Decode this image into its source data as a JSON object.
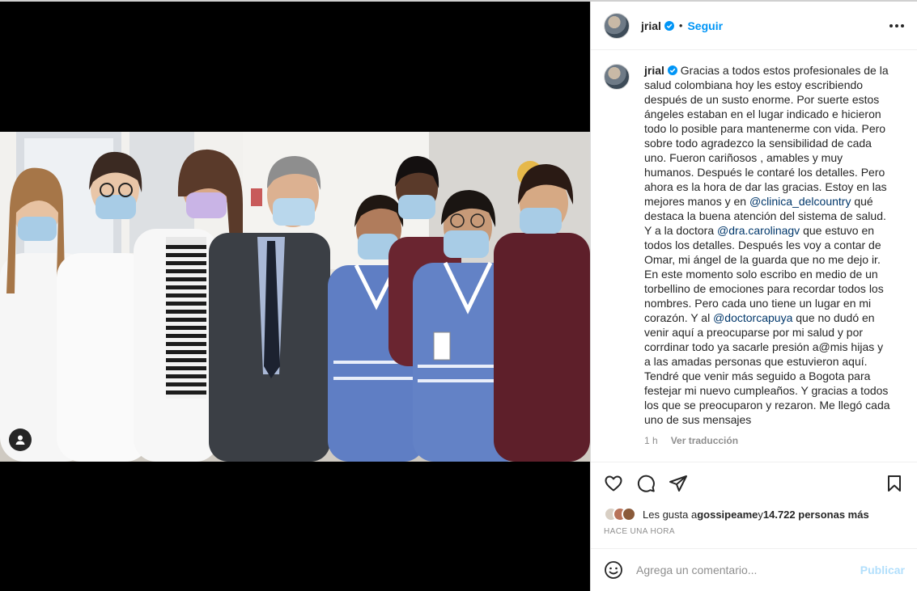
{
  "post": {
    "username": "jrial",
    "follow_label": "Seguir",
    "dot": "•",
    "photo_alt": "Grupo de profesionales de la salud con un hombre de traje en un hospital"
  },
  "caption": {
    "username": "jrial",
    "text_part1": "Gracias a todos estos profesionales de la salud colombiana hoy les estoy escribiendo después de un susto enorme. Por suerte estos ángeles estaban en el lugar indicado e hicieron todo lo posible para mantenerme con vida. Pero sobre todo agradezco la sensibilidad de cada uno. Fueron cariñosos , amables y muy humanos. Después le contaré los detalles. Pero ahora es la hora de dar las gracias. Estoy en las mejores manos y en ",
    "mention1": "@clinica_delcountry",
    "text_part2": " qué destaca la buena atención del sistema de salud. Y a la doctora ",
    "mention2": "@dra.carolinagv",
    "text_part3": " que estuvo en todos los detalles. Después les voy a contar de Omar, mi ángel de la guarda que no me dejo ir. En este momento solo escribo en medio de un torbellino de emociones para recordar todos los nombres. Pero cada uno tiene un lugar en mi corazón. Y al ",
    "mention3": "@doctorcapuya",
    "text_part4": " que no dudó en venir aquí a preocuparse por mi salud y por corrdinar todo ya sacarle presión a@mis hijas y a las amadas personas que estuvieron aquí. Tendré que venir más seguido a Bogota para festejar mi nuevo cumpleaños. Y gracias a todos los que se preocuparon y rezaron. Me llegó cada uno de sus mensajes",
    "time": "1 h",
    "translate_label": "Ver traducción"
  },
  "likes": {
    "prefix": "Les gusta a ",
    "liker": "gossipeame",
    "middle": " y ",
    "others": "14.722 personas más"
  },
  "timeago": "HACE UNA HORA",
  "comment": {
    "placeholder": "Agrega un comentario...",
    "publish_label": "Publicar"
  },
  "colors": {
    "accent": "#0095f6",
    "publish_disabled": "#b2dffc",
    "mention": "#00376b",
    "muted": "#8e8e8e"
  },
  "icons": [
    "tag-user-icon",
    "verified-badge-icon",
    "more-options-icon",
    "heart-icon",
    "comment-icon",
    "share-icon",
    "bookmark-icon",
    "emoji-icon"
  ]
}
